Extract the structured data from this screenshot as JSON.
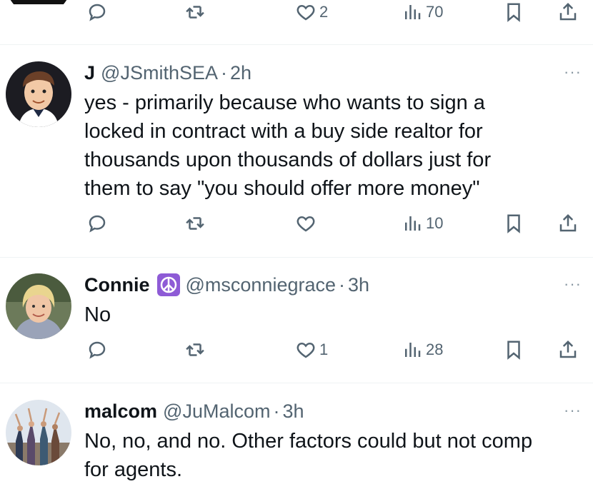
{
  "tweets": [
    {
      "actions": {
        "reply": "",
        "retweet": "",
        "like": "2",
        "views": "70"
      }
    },
    {
      "name": "J",
      "handle": "@JSmithSEA",
      "separator": "·",
      "time": "2h",
      "lines": [
        "yes - primarily because who wants to sign a",
        "locked in contract with a buy side realtor for",
        "thousands upon thousands of dollars just for",
        "them to say \"you should offer more money\""
      ],
      "actions": {
        "reply": "",
        "retweet": "",
        "like": "",
        "views": "10"
      }
    },
    {
      "name": "Connie",
      "badge_icon": "peace-symbol-icon",
      "handle": "@msconniegrace",
      "separator": "·",
      "time": "3h",
      "lines": [
        "No"
      ],
      "actions": {
        "reply": "",
        "retweet": "",
        "like": "1",
        "views": "28"
      }
    },
    {
      "name": "malcom",
      "handle": "@JuMalcom",
      "separator": "·",
      "time": "3h",
      "lines": [
        "No, no, and no. Other factors could but not comp",
        "for agents."
      ]
    }
  ],
  "more_label": "···",
  "colors": {
    "text": "#0f1419",
    "muted": "#536471",
    "divider": "#eff3f4",
    "emoji_bg": "#8e5bd6"
  }
}
